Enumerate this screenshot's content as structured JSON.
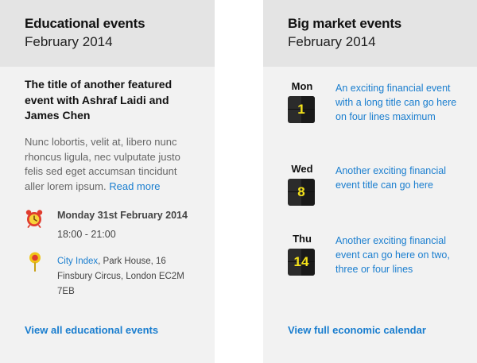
{
  "educational": {
    "title": "Educational events",
    "subtitle": "February 2014",
    "featured_title": "The title of another featured event with Ashraf Laidi and James Chen",
    "description": "Nunc lobortis, velit at, libero nunc rhoncus ligula, nec vulputate justo felis sed eget accumsan tincidunt aller lorem ipsum.",
    "read_more": "Read more",
    "date": "Monday 31st February 2014",
    "time": "18:00 - 21:00",
    "location_link": "City Index",
    "location_rest": ", Park House, 16 Finsbury Circus, London EC2M 7EB",
    "footer_link": "View all educational events",
    "icons": {
      "clock": "alarm-clock-icon",
      "pin": "location-pin-icon"
    },
    "colors": {
      "link": "#1a7ecf",
      "clock": "#e03c2e",
      "pin": "#f0c419"
    }
  },
  "market": {
    "title": "Big market events",
    "subtitle": "February 2014",
    "events": [
      {
        "day": "Mon",
        "date": "1",
        "text": "An exciting financial event with a long title can go here on four lines maximum"
      },
      {
        "day": "Wed",
        "date": "8",
        "text": "Another exciting financial event title can go here"
      },
      {
        "day": "Thu",
        "date": "14",
        "text": "Another exciting financial event can go here on two, three or four lines"
      }
    ],
    "footer_link": "View full economic calendar",
    "colors": {
      "calendar_bg": "#2b2b2b",
      "calendar_num": "#f4e21a"
    }
  }
}
